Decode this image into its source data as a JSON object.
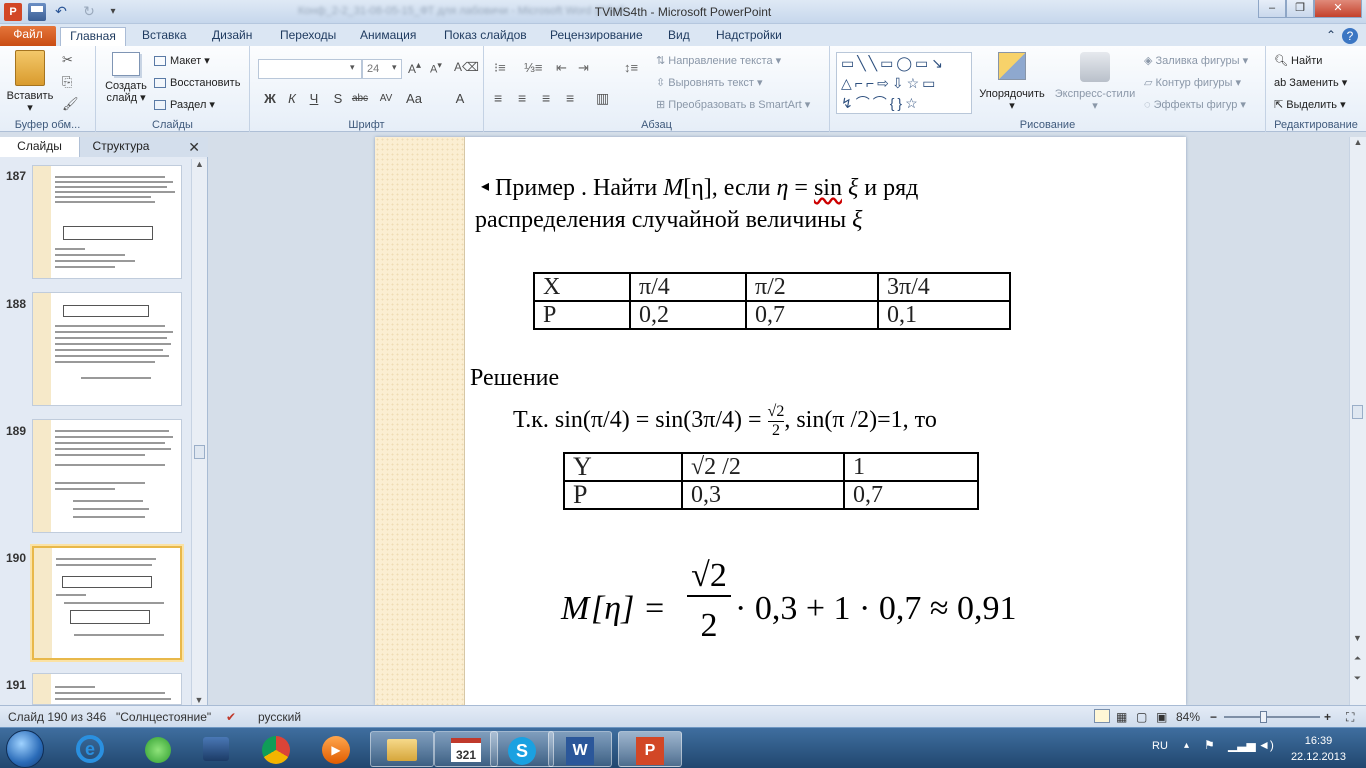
{
  "window": {
    "app_title": "TViMS4th  -  Microsoft PowerPoint",
    "blurred_file_label": "Конф_2-2_31-08-05-15_ФТ для лабовичи - Microsoft Word (Сбой...",
    "minimize": "–",
    "restore": "❐",
    "close": "✕"
  },
  "tabs": [
    "Файл",
    "Главная",
    "Вставка",
    "Дизайн",
    "Переходы",
    "Анимация",
    "Показ слайдов",
    "Рецензирование",
    "Вид",
    "Надстройки"
  ],
  "ribbon": {
    "clipboard": {
      "paste": "Вставить",
      "label": "Буфер обм..."
    },
    "slides": {
      "new_slide_1": "Создать",
      "new_slide_2": "слайд",
      "layout": "Макет",
      "reset": "Восстановить",
      "section": "Раздел",
      "label": "Слайды"
    },
    "font": {
      "name": "",
      "size": "24",
      "label": "Шрифт"
    },
    "paragraph": {
      "text_direction": "Направление текста",
      "align_text": "Выровнять текст",
      "smartart": "Преобразовать в SmartArt",
      "label": "Абзац"
    },
    "drawing": {
      "arrange": "Упорядочить",
      "quick_styles": "Экспресс-стили",
      "fill": "Заливка фигуры",
      "outline": "Контур фигуры",
      "effects": "Эффекты фигур",
      "label": "Рисование"
    },
    "editing": {
      "find": "Найти",
      "replace": "Заменить",
      "select": "Выделить",
      "label": "Редактирование"
    }
  },
  "left_pane": {
    "tab_slides": "Слайды",
    "tab_outline": "Структура",
    "close": "✕",
    "thumbs": [
      {
        "num": "187"
      },
      {
        "num": "188"
      },
      {
        "num": "189"
      },
      {
        "num": "190"
      },
      {
        "num": "191"
      }
    ]
  },
  "slide": {
    "bullet": "◂",
    "title_part1": "Пример . Найти ",
    "title_m": "M",
    "title_eta_br": "[η]",
    "title_part2": ", если ",
    "title_eta": "η",
    "title_eq": " = ",
    "title_sin": "sin",
    "title_xi": "ξ",
    "title_part3": " и ряд",
    "title_line2": "распределения случайной величины ",
    "title_xi2": "ξ",
    "table1": {
      "rows": [
        [
          "X",
          "π/4",
          "π/2",
          "3π/4"
        ],
        [
          "P",
          "0,2",
          "0,7",
          "0,1"
        ]
      ]
    },
    "solution_label": "Решение",
    "since_part1": "Т.к. sin(π/4) = sin(3π/4) = ",
    "since_frac_num": "√2",
    "since_frac_den": "2",
    "since_part2": ", sin(π /2)=1, то",
    "table2": {
      "rows": [
        [
          "Y",
          "√2 /2",
          "1"
        ],
        [
          "P",
          "0,3",
          "0,7"
        ]
      ]
    },
    "formula_lhs": "M",
    "formula_eta": "[η] =",
    "formula_num": "√2",
    "formula_den": "2",
    "formula_rest": "· 0,3 + 1 · 0,7 ≈ 0,91"
  },
  "status": {
    "slide_of": "Слайд 190 из 346",
    "theme": "\"Солнцестояние\"",
    "language": "русский",
    "zoom": "84%",
    "zoom_minus": "−",
    "zoom_plus": "+"
  },
  "taskbar": {
    "lang": "RU",
    "time": "16:39",
    "date": "22.12.2013"
  },
  "colors": {
    "file_tab": "#d4601f",
    "ribbon_bg": "#e6eef8",
    "slide_strip": "#fbeed2",
    "taskbar": "#2b5582"
  }
}
